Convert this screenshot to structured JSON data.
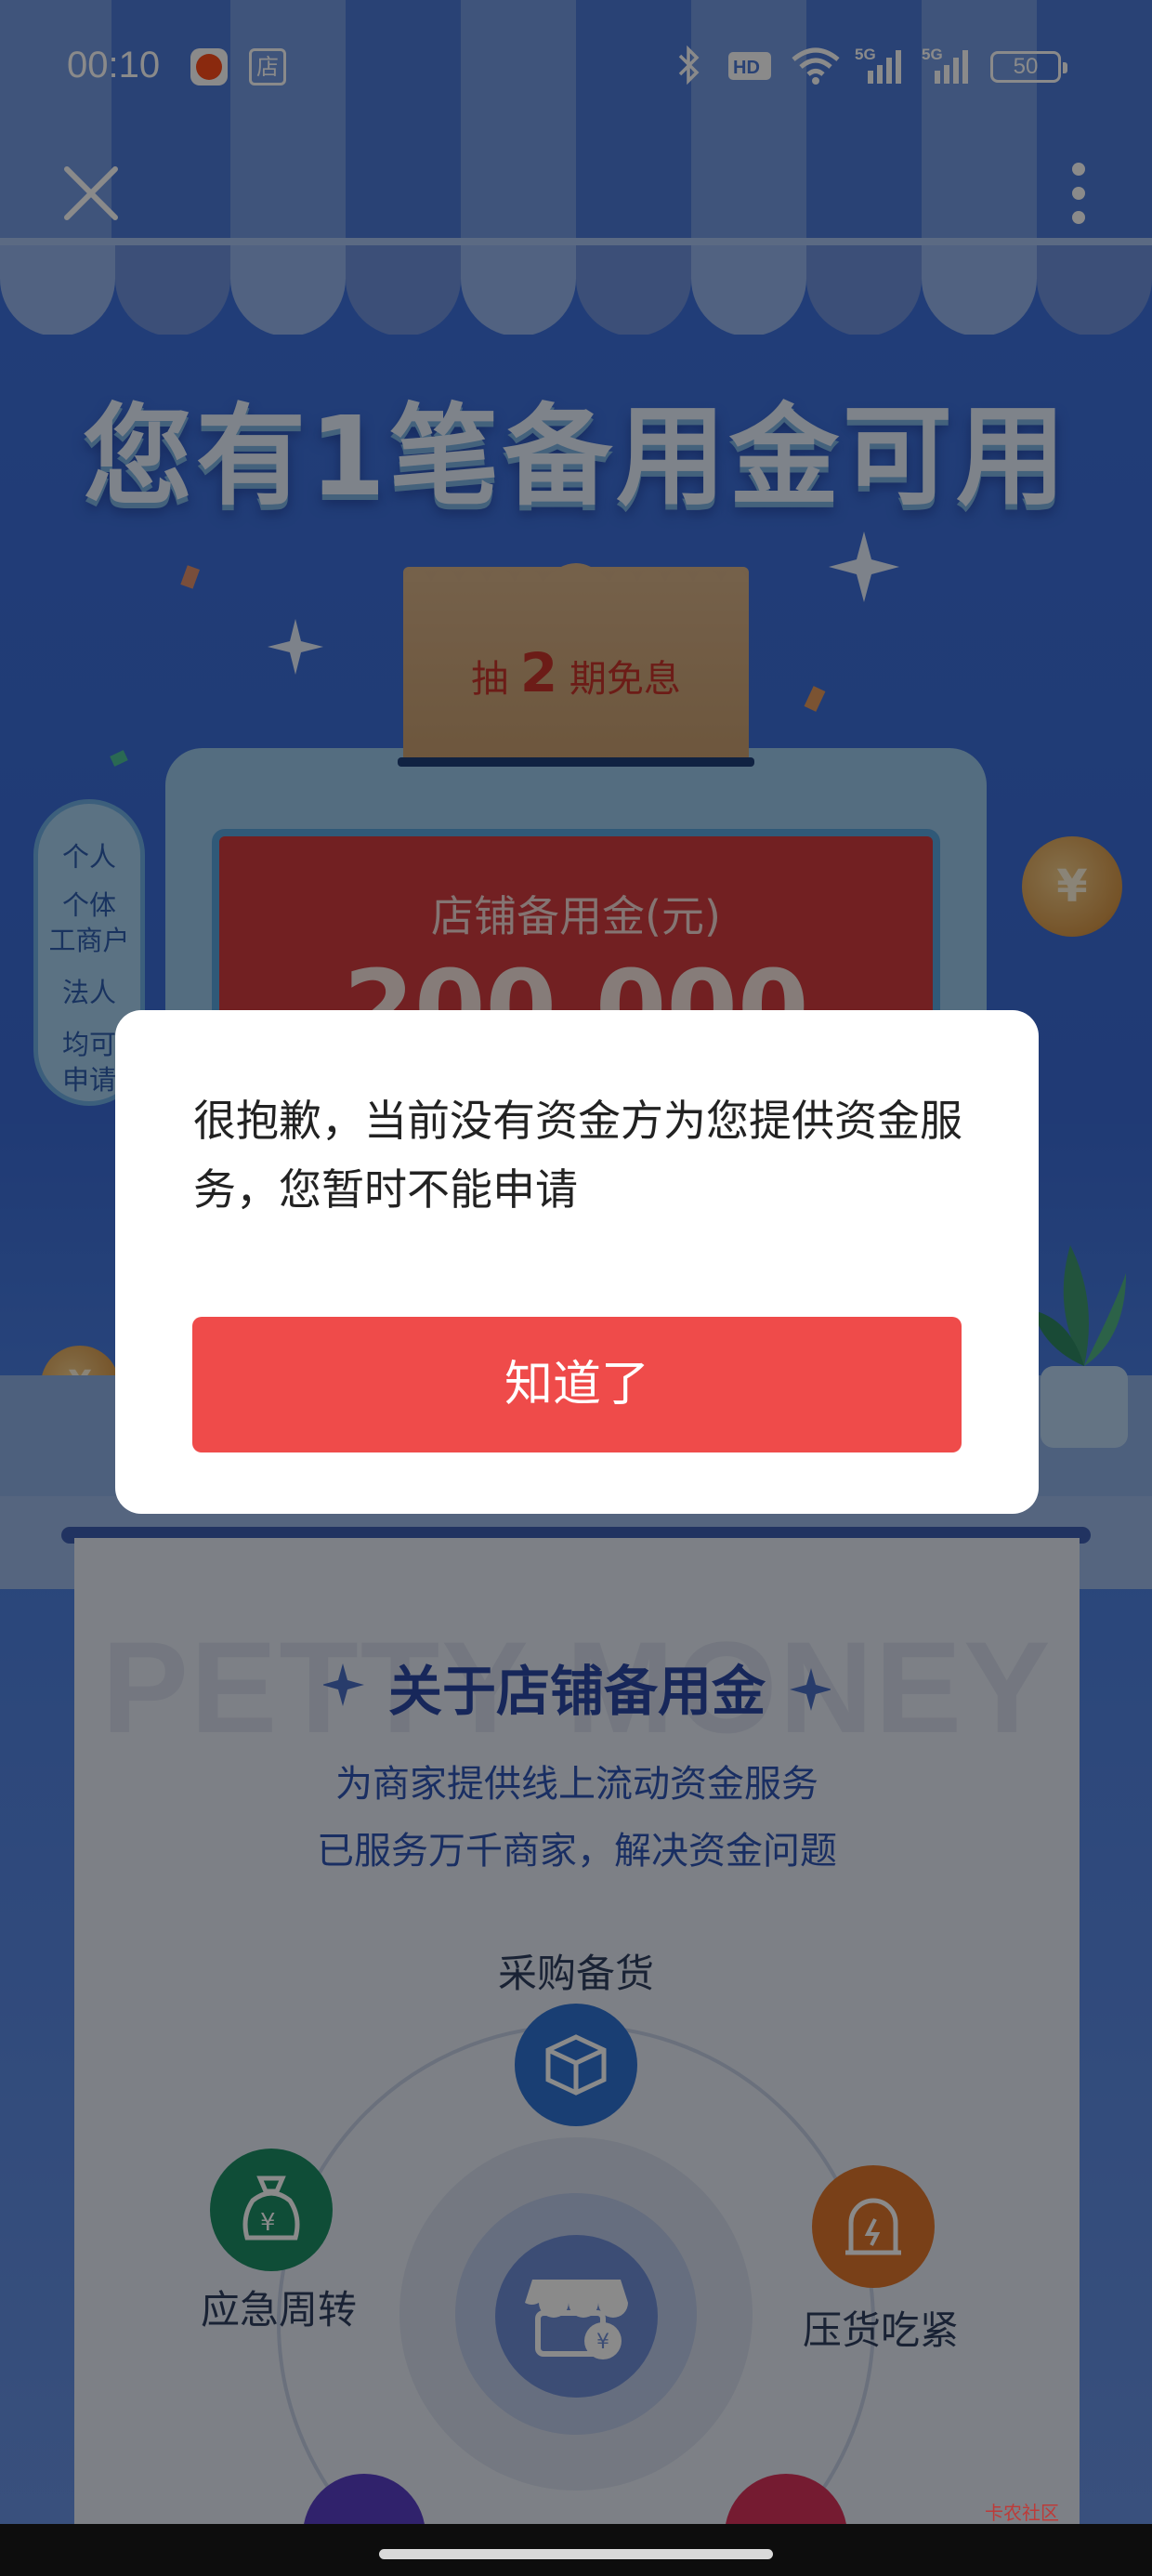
{
  "status_bar": {
    "time": "00:10",
    "app_badge": "店",
    "signal_label": "5G",
    "hd_label": "HD",
    "battery": "50"
  },
  "page": {
    "headline": "您有1笔备用金可用",
    "ticket": {
      "prefix": "抽",
      "number": "2",
      "suffix": "期免息"
    },
    "screen_label": "店铺备用金(元)",
    "screen_amount": "200,000",
    "side_tags": [
      "个人",
      "个体",
      "工商户",
      "法人",
      "均可",
      "申请"
    ],
    "coin_symbol": "¥"
  },
  "about": {
    "watermark": "PETTY MONEY",
    "title": "关于店铺备用金",
    "lines": [
      "为商家提供线上流动资金服务",
      "已服务万千商家，解决资金问题"
    ],
    "features": {
      "purchase": "采购备货",
      "emergency": "应急周转",
      "stock": "压货吃紧"
    }
  },
  "dialog": {
    "message": "很抱歉，当前没有资金方为您提供资金服务，您暂时不能申请",
    "button": "知道了"
  },
  "watermark_site": "卡农社区",
  "colors": {
    "accent": "#ef4b4a",
    "background": "#3b6cd8",
    "headline": "#e9f2ff"
  }
}
